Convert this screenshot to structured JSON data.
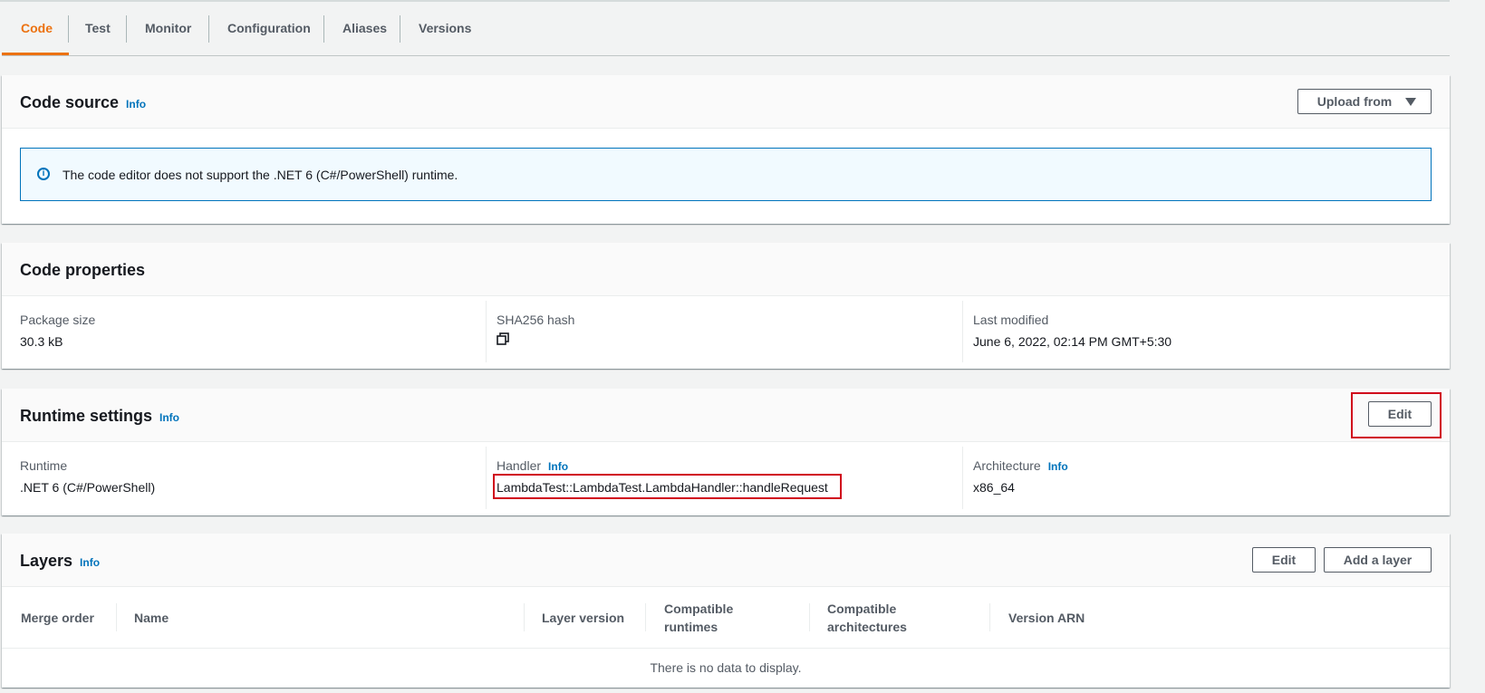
{
  "tabs": [
    {
      "label": "Code"
    },
    {
      "label": "Test"
    },
    {
      "label": "Monitor"
    },
    {
      "label": "Configuration"
    },
    {
      "label": "Aliases"
    },
    {
      "label": "Versions"
    }
  ],
  "code_source": {
    "title": "Code source",
    "info": "Info",
    "upload_button": "Upload from",
    "alert_text": "The code editor does not support the .NET 6 (C#/PowerShell) runtime."
  },
  "code_properties": {
    "title": "Code properties",
    "package_size_label": "Package size",
    "package_size_value": "30.3 kB",
    "sha_label": "SHA256 hash",
    "last_modified_label": "Last modified",
    "last_modified_value": "June 6, 2022, 02:14 PM GMT+5:30"
  },
  "runtime_settings": {
    "title": "Runtime settings",
    "info": "Info",
    "edit_button": "Edit",
    "runtime_label": "Runtime",
    "runtime_value": ".NET 6 (C#/PowerShell)",
    "handler_label": "Handler",
    "handler_info": "Info",
    "handler_value": "LambdaTest::LambdaTest.LambdaHandler::handleRequest",
    "architecture_label": "Architecture",
    "architecture_info": "Info",
    "architecture_value": "x86_64"
  },
  "layers": {
    "title": "Layers",
    "info": "Info",
    "edit_button": "Edit",
    "add_button": "Add a layer",
    "columns": {
      "merge_order": "Merge order",
      "name": "Name",
      "layer_version": "Layer version",
      "compatible_runtimes_1": "Compatible",
      "compatible_runtimes_2": "runtimes",
      "compatible_architectures_1": "Compatible",
      "compatible_architectures_2": "architectures",
      "version_arn": "Version ARN"
    },
    "empty_message": "There is no data to display."
  },
  "icons": {
    "info_circle": "info-circle-icon",
    "copy": "copy-icon",
    "caret_down": "caret-down-icon"
  },
  "colors": {
    "accent": "#ec7211",
    "link": "#0073bb",
    "highlight": "#d0021b"
  }
}
